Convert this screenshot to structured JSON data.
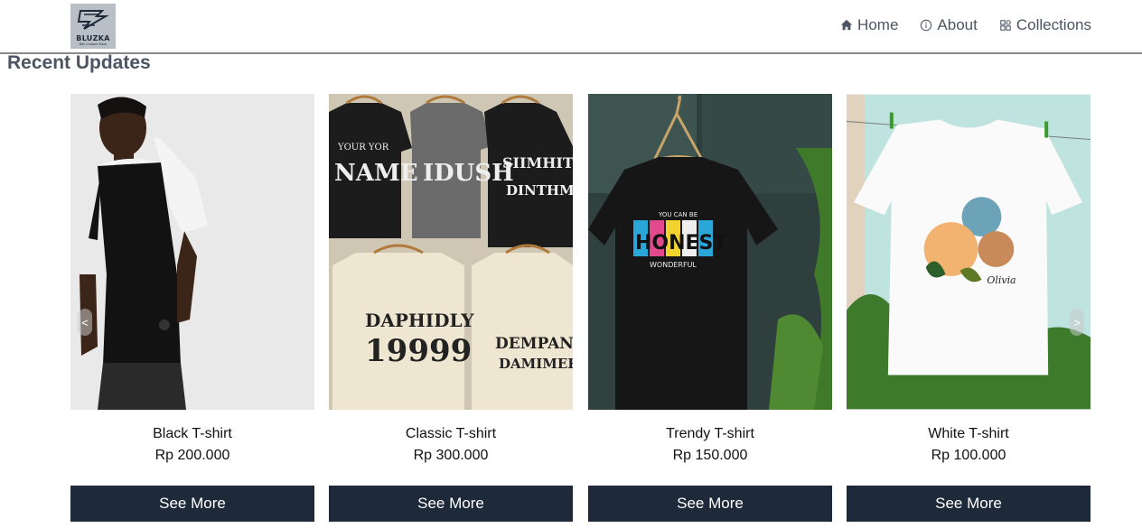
{
  "brand": {
    "name": "BLUZKA",
    "tagline": "Bali Custom Kaos"
  },
  "nav": {
    "items": [
      {
        "label": "Home",
        "icon": "home-icon"
      },
      {
        "label": "About",
        "icon": "info-icon"
      },
      {
        "label": "Collections",
        "icon": "grid-icon"
      }
    ]
  },
  "section": {
    "title": "Recent Updates"
  },
  "products": [
    {
      "name": "Black T-shirt",
      "price": "Rp 200.000",
      "button": "See More"
    },
    {
      "name": "Classic T-shirt",
      "price": "Rp 300.000",
      "button": "See More"
    },
    {
      "name": "Trendy T-shirt",
      "price": "Rp 150.000",
      "button": "See More"
    },
    {
      "name": "White T-shirt",
      "price": "Rp 100.000",
      "button": "See More"
    }
  ],
  "carousel": {
    "prev": "<",
    "next": ">"
  },
  "print_text": {
    "shirt1": "YOUR YOR",
    "shirt1b": "NAME",
    "shirt2": "IDUSH",
    "shirt3": "SIIMHITY",
    "shirt3b": "DINTHMY",
    "shirt4": "DAPHIDLY",
    "shirt4b": "19999",
    "shirt5": "DEMPANBE",
    "shirt5b": "DAMIMERA",
    "honest": "HONEST",
    "honest_top": "YOU CAN BE",
    "honest_bottom": "WONDERFUL",
    "white_sig": "Olivia"
  },
  "colors": {
    "button_bg": "#1e2939",
    "nav_text": "#4b5563",
    "logo_bg": "#b9bfc6"
  }
}
